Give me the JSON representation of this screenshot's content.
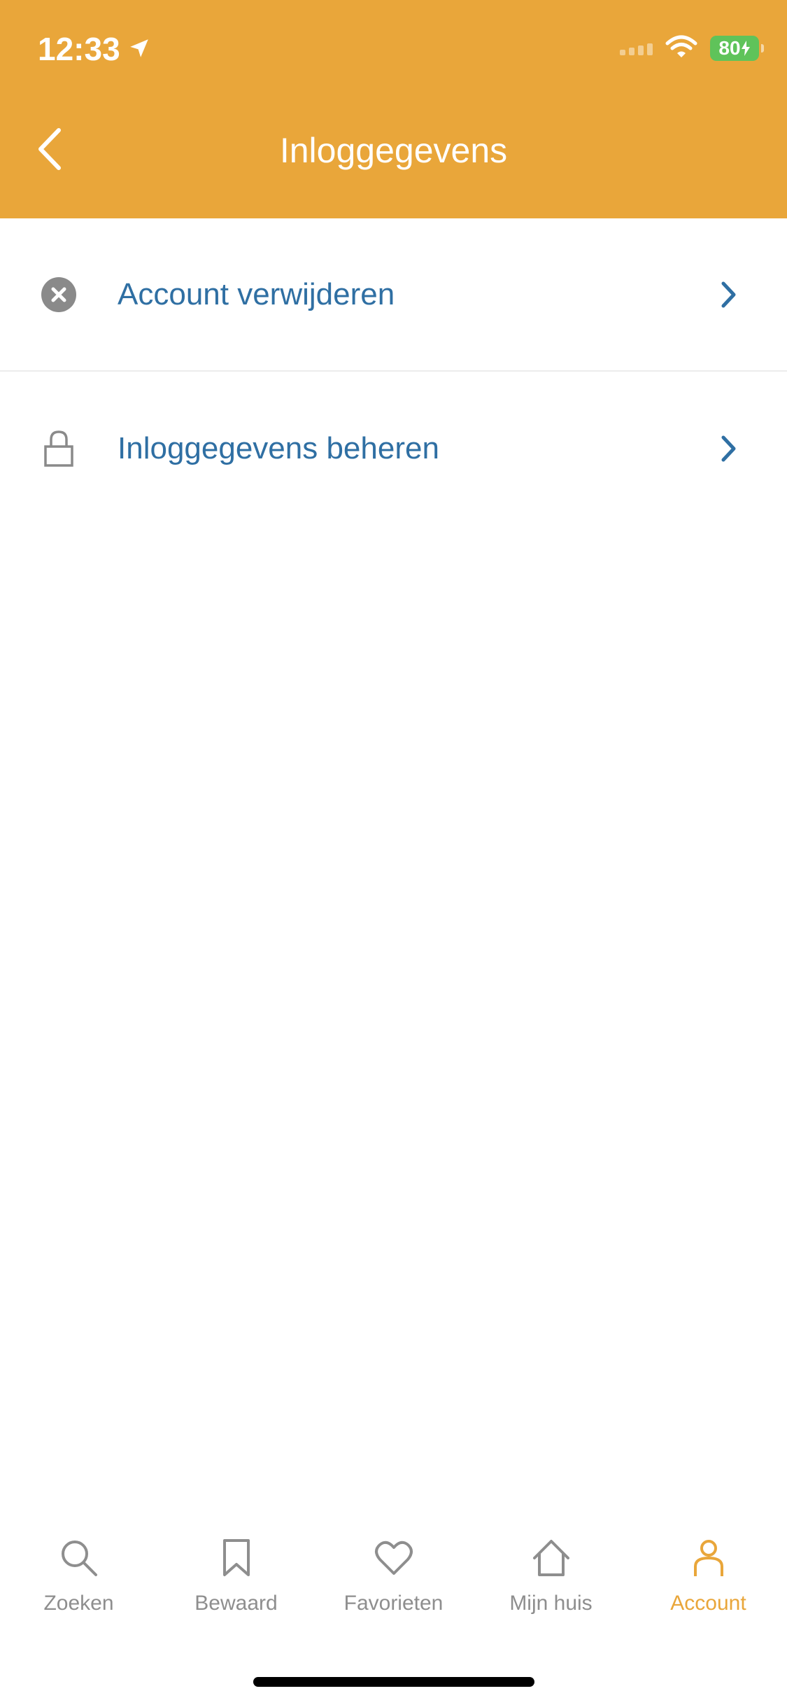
{
  "status_bar": {
    "time": "12:33",
    "battery": "80"
  },
  "header": {
    "title": "Inloggegevens",
    "background_color": "#E9A63A"
  },
  "menu": {
    "items": [
      {
        "label": "Account verwijderen",
        "icon": "close-circle-icon"
      },
      {
        "label": "Inloggegevens beheren",
        "icon": "lock-icon"
      }
    ],
    "label_color": "#2F6FA3"
  },
  "tabbar": {
    "active_color": "#E9A63A",
    "inactive_color": "#8E8E8E",
    "tabs": [
      {
        "label": "Zoeken",
        "icon": "search-icon",
        "active": false
      },
      {
        "label": "Bewaard",
        "icon": "bookmark-icon",
        "active": false
      },
      {
        "label": "Favorieten",
        "icon": "heart-icon",
        "active": false
      },
      {
        "label": "Mijn huis",
        "icon": "house-icon",
        "active": false
      },
      {
        "label": "Account",
        "icon": "person-icon",
        "active": true
      }
    ]
  }
}
